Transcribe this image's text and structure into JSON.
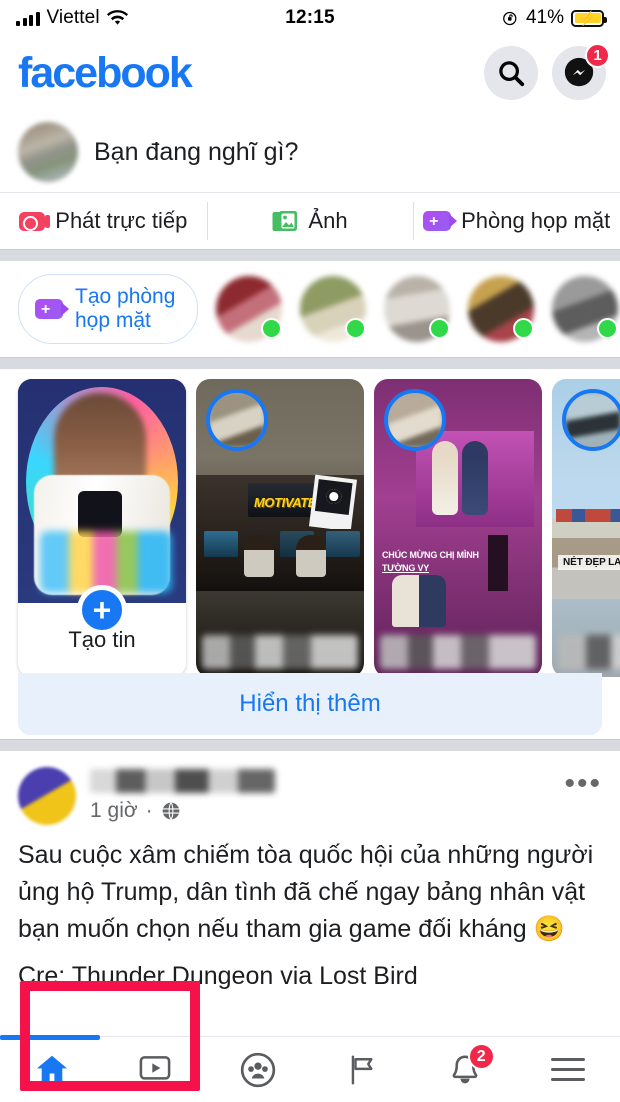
{
  "status_bar": {
    "carrier": "Viettel",
    "time": "12:15",
    "battery_percent": "41%",
    "icons": [
      "signal-bars-icon",
      "wifi-icon",
      "rotation-lock-icon",
      "battery-charging-icon"
    ]
  },
  "top_bar": {
    "logo_text": "facebook",
    "logo_color": "#1877F2",
    "search_icon": "search-icon",
    "messenger_icon": "messenger-icon",
    "messenger_badge": "1"
  },
  "composer": {
    "placeholder": "Bạn đang nghĩ gì?",
    "actions": [
      {
        "label": "Phát trực tiếp",
        "icon": "live-video-icon",
        "color": "#F3425F"
      },
      {
        "label": "Ảnh",
        "icon": "photo-icon",
        "color": "#45BD62"
      },
      {
        "label": "Phòng họp mặt",
        "icon": "room-video-icon",
        "color": "#A33EF7"
      }
    ]
  },
  "rooms": {
    "create_button_line1": "Tạo phòng",
    "create_button_line2": "họp mặt",
    "create_button_icon": "add-video-room-icon",
    "online_indicator_color": "#31D94A",
    "avatars": [
      {
        "name": "room-avatar-1",
        "online": true
      },
      {
        "name": "room-avatar-2",
        "online": true
      },
      {
        "name": "room-avatar-3",
        "online": true
      },
      {
        "name": "room-avatar-4",
        "online": true
      },
      {
        "name": "room-avatar-5",
        "online": true
      }
    ]
  },
  "stories": {
    "create_story_label": "Tạo tin",
    "create_story_plus": "+",
    "show_more_label": "Hiển thị thêm",
    "items": [
      {
        "name": "story-create",
        "caption": "Tạo tin"
      },
      {
        "name": "story-2",
        "overlay_text": "MOTIVATED"
      },
      {
        "name": "story-3",
        "overlay_text": "CHÚC MỪNG CHỊ MÌNH",
        "overlay_text2": "TƯỜNG VY"
      },
      {
        "name": "story-4",
        "overlay_text": "NÉT ĐẸP LAO ĐỘNG"
      }
    ]
  },
  "annotation": {
    "color": "#F5124A",
    "target": "Tạo tin"
  },
  "post": {
    "timestamp": "1 giờ",
    "separator": "·",
    "privacy_icon": "globe-icon",
    "menu_icon": "more-options-icon",
    "body_line1": "Sau cuộc xâm chiếm tòa quốc hội của những người ủng",
    "body_line2": "hộ Trump, dân tình đã chế ngay bảng nhân vật bạn muốn",
    "body_line3": "chọn nếu tham gia game đối kháng 😆",
    "credit": "Cre: Thunder Dungeon via Lost Bird"
  },
  "bottom_nav": {
    "active_color": "#1877F2",
    "items": [
      {
        "name": "nav-home",
        "icon": "home-icon",
        "active": true,
        "badge": ""
      },
      {
        "name": "nav-watch",
        "icon": "watch-video-icon",
        "active": false,
        "badge": ""
      },
      {
        "name": "nav-groups",
        "icon": "groups-icon",
        "active": false,
        "badge": ""
      },
      {
        "name": "nav-pages",
        "icon": "flag-pages-icon",
        "active": false,
        "badge": ""
      },
      {
        "name": "nav-notifications",
        "icon": "bell-icon",
        "active": false,
        "badge": "2"
      },
      {
        "name": "nav-menu",
        "icon": "hamburger-menu-icon",
        "active": false,
        "badge": ""
      }
    ]
  }
}
